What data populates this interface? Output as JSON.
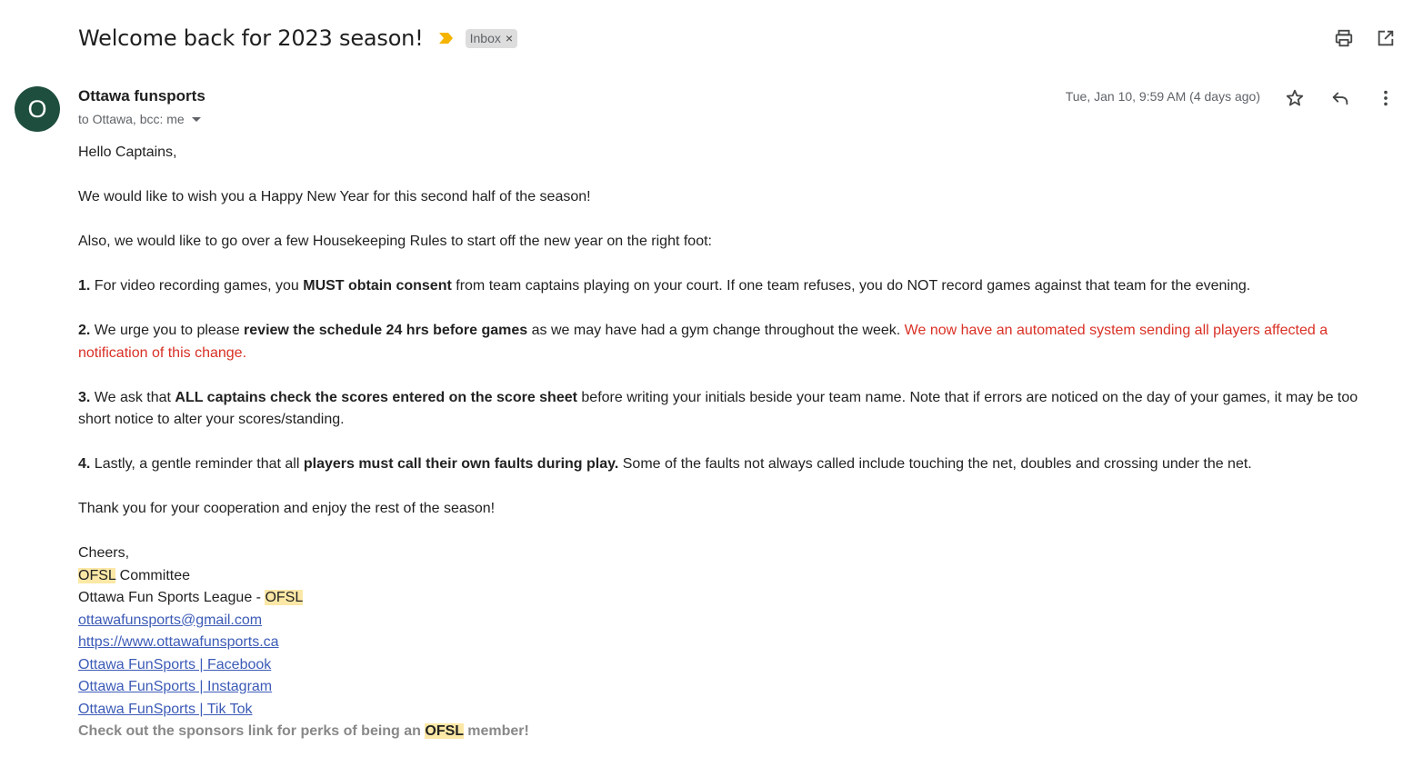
{
  "email": {
    "subject": "Welcome back for 2023 season!",
    "label": "Inbox",
    "label_remove": "×",
    "sender": {
      "avatar_letter": "O",
      "name": "Ottawa funsports",
      "recipients": "to Ottawa, bcc: me",
      "date": "Tue, Jan 10, 9:59 AM (4 days ago)"
    },
    "body": {
      "greeting": "Hello Captains,",
      "p1": "We would like to wish you a Happy New Year for this second half of the season!",
      "p2": "Also, we would like to go over a few Housekeeping Rules to start off the new year on the right foot:",
      "rule1": {
        "num": "1.",
        "a": " For video recording games, you ",
        "b": "MUST obtain consent",
        "c": " from team captains playing on your court.  If one team refuses, you do NOT record games against that team for the evening."
      },
      "rule2": {
        "num": "2.",
        "a": " We urge you to please ",
        "b": "review the schedule 24 hrs before games",
        "c": " as we may have had a gym change throughout the week.  ",
        "d": "We now have an automated system sending all players affected a notification of this change."
      },
      "rule3": {
        "num": "3.",
        "a": " We ask that ",
        "b": "ALL captains check the scores entered on the score sheet",
        "c": " before writing your initials beside your team name.  Note that if errors are noticed on the day of your games, it may be too short notice to alter your scores/standing."
      },
      "rule4": {
        "num": "4.",
        "a": " Lastly, a gentle reminder that all ",
        "b": "players must call their own faults during play.",
        "c": "  Some of the faults not always called include touching the net, doubles and crossing under the net."
      },
      "thanks": "Thank you for your cooperation and enjoy the rest of the season!"
    },
    "signature": {
      "closing": "Cheers,",
      "abbr": "OFSL",
      "committee": " Committee",
      "league": "Ottawa Fun Sports League - ",
      "email": "ottawafunsports@gmail.com",
      "website": "https://www.ottawafunsports.ca",
      "facebook": "Ottawa FunSports | Facebook",
      "instagram": "Ottawa FunSports | Instagram",
      "tiktok": "Ottawa FunSports | Tik Tok",
      "footer_a": "Check out the sponsors link for perks of being an ",
      "footer_b": " member!"
    }
  },
  "icons": {
    "importance": "importance-marker-icon",
    "print": "print-icon",
    "open_new": "open-in-new-window-icon",
    "star": "star-icon",
    "reply": "reply-icon",
    "more": "more-vertical-icon"
  },
  "colors": {
    "avatar_bg": "#1e4e3d",
    "importance": "#f4b400",
    "link": "#3c5bb7",
    "highlight": "#fce8a6",
    "red_text": "#d93025"
  }
}
